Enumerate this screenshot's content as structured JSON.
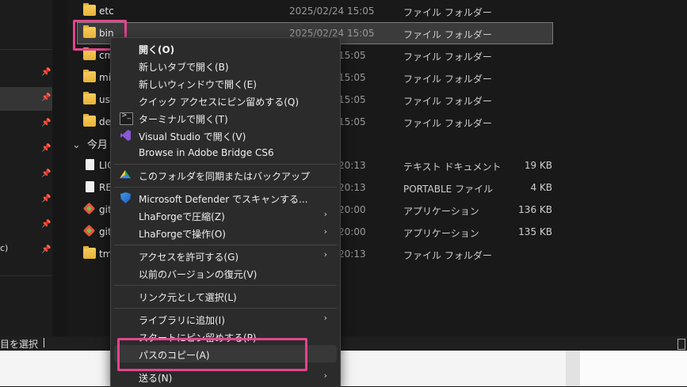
{
  "files": [
    {
      "name": "etc",
      "date": "2025/02/24 15:05",
      "type": "ファイル フォルダー",
      "size": "",
      "icon": "folder-icon"
    },
    {
      "name": "bin",
      "date": "2025/02/24 15:05",
      "type": "ファイル フォルダー",
      "size": "",
      "icon": "folder-icon",
      "selected": true
    },
    {
      "name": "cm",
      "date": "15:05",
      "type": "ファイル フォルダー",
      "size": "",
      "icon": "folder-icon"
    },
    {
      "name": "mi",
      "date": "15:05",
      "type": "ファイル フォルダー",
      "size": "",
      "icon": "folder-icon"
    },
    {
      "name": "us",
      "date": "15:05",
      "type": "ファイル フォルダー",
      "size": "",
      "icon": "folder-icon"
    },
    {
      "name": "de",
      "date": "15:05",
      "type": "ファイル フォルダー",
      "size": "",
      "icon": "folder-icon"
    },
    {
      "name": "LIC",
      "date": "20:13",
      "type": "テキスト ドキュメント",
      "size": "19 KB",
      "icon": "document-icon"
    },
    {
      "name": "RE",
      "date": "20:13",
      "type": "PORTABLE ファイル",
      "size": "4 KB",
      "icon": "document-icon"
    },
    {
      "name": "git",
      "date": "20:00",
      "type": "アプリケーション",
      "size": "136 KB",
      "icon": "git-app-icon"
    },
    {
      "name": "git",
      "date": "20:00",
      "type": "アプリケーション",
      "size": "135 KB",
      "icon": "git-app-icon"
    },
    {
      "name": "tm",
      "date": "20:13",
      "type": "ファイル フォルダー",
      "size": "",
      "icon": "folder-icon"
    }
  ],
  "group": {
    "label": "今月",
    "chevron": "chevron-down-icon"
  },
  "nav": {
    "fragment": "c)"
  },
  "status": {
    "text": "目を選択"
  },
  "context_menu": {
    "items": [
      {
        "label": "開く(O)",
        "bold": true,
        "icon": ""
      },
      {
        "label": "新しいタブで開く(B)",
        "icon": ""
      },
      {
        "label": "新しいウィンドウで開く(E)",
        "icon": ""
      },
      {
        "label": "クイック アクセスにピン留めする(Q)",
        "icon": ""
      },
      {
        "label": "ターミナルで開く(T)",
        "icon": "terminal-icon"
      },
      {
        "label": "Visual Studio で開く(V)",
        "icon": "visual-studio-icon"
      },
      {
        "label": "Browse in Adobe Bridge CS6",
        "icon": ""
      },
      {
        "label": "このフォルダを同期またはバックアップ",
        "icon": "google-drive-icon"
      },
      {
        "label": "Microsoft Defender でスキャンする...",
        "icon": "defender-icon"
      },
      {
        "label": "LhaForgeで圧縮(Z)",
        "icon": "",
        "submenu": true
      },
      {
        "label": "LhaForgeで操作(O)",
        "icon": "",
        "submenu": true
      },
      {
        "label": "アクセスを許可する(G)",
        "icon": "",
        "submenu": true
      },
      {
        "label": "以前のバージョンの復元(V)",
        "icon": ""
      },
      {
        "label": "リンク元として選択(L)",
        "icon": ""
      },
      {
        "label": "ライブラリに追加(I)",
        "icon": "",
        "submenu": true
      },
      {
        "label": "スタートにピン留めする(P)",
        "icon": ""
      },
      {
        "label": "パスのコピー(A)",
        "icon": "",
        "highlighted": true
      },
      {
        "label": "送る(N)",
        "icon": "",
        "submenu": true
      }
    ],
    "submenu_arrow": "›"
  },
  "colors": {
    "highlight": "#e5448f",
    "background": "#191919",
    "menu": "#2b2b2b"
  }
}
